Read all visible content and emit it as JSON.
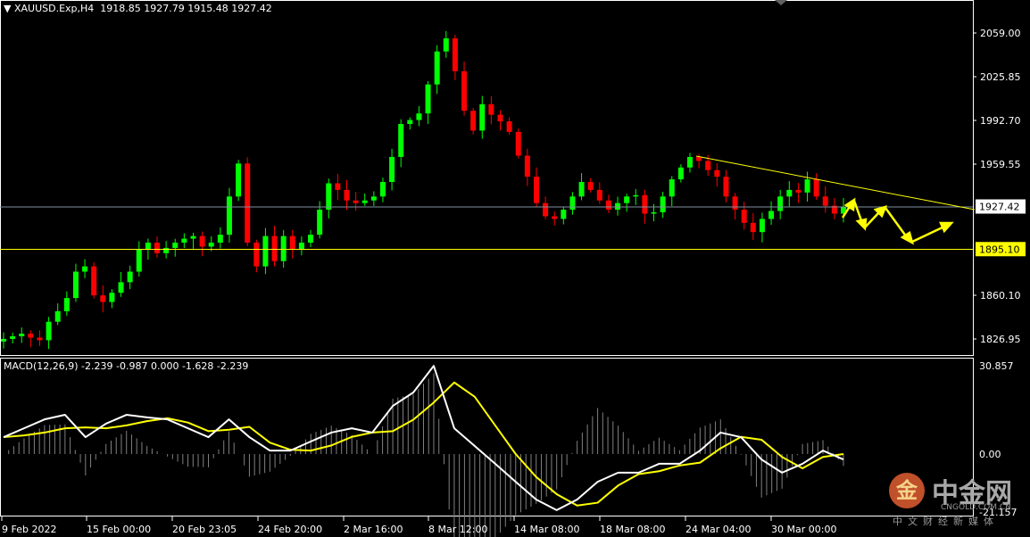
{
  "header": {
    "symbol": "XAUUSD.Exp,H4",
    "ohlc": "1918.85 1927.79 1915.48 1927.42"
  },
  "macd_header": "MACD(12,26,9) -2.239 -0.987 0.000 -1.628 -2.239",
  "colors": {
    "bull": "#00ff00",
    "bear": "#ff0000",
    "macd": "#ffffff",
    "signal": "#ffff00",
    "histogram": "#808080",
    "trendline": "#ffff00",
    "support": "#ffff00",
    "current": "#8090a0"
  },
  "watermark": {
    "logo": "金",
    "name": "中金网",
    "site": "CNGOLD.COM.CN",
    "tagline": "中文财经新媒体"
  },
  "chart_data": [
    {
      "type": "candlestick",
      "title": "XAUUSD.Exp,H4",
      "ylim": [
        1810,
        2075
      ],
      "yticks": [
        "2059.00",
        "2025.85",
        "1992.70",
        "1959.55",
        "1927.42",
        "1895.10",
        "1860.10",
        "1826.95"
      ],
      "xticks": [
        "9 Feb 2022",
        "15 Feb 00:00",
        "20 Feb 23:05",
        "24 Feb 20:00",
        "2 Mar 16:00",
        "8 Mar 12:00",
        "14 Mar 08:00",
        "18 Mar 08:00",
        "24 Mar 04:00",
        "30 Mar 00:00"
      ],
      "closes": [
        1827,
        1829,
        1831,
        1828,
        1826,
        1840,
        1848,
        1858,
        1878,
        1882,
        1860,
        1855,
        1862,
        1870,
        1878,
        1895,
        1900,
        1892,
        1896,
        1900,
        1903,
        1905,
        1897,
        1900,
        1906,
        1935,
        1960,
        1900,
        1882,
        1905,
        1886,
        1905,
        1895,
        1900,
        1906,
        1925,
        1945,
        1940,
        1932,
        1930,
        1932,
        1935,
        1946,
        1965,
        1990,
        1993,
        1998,
        2020,
        2045,
        2055,
        2030,
        2000,
        1985,
        2005,
        1997,
        1992,
        1984,
        1966,
        1950,
        1930,
        1920,
        1918,
        1925,
        1935,
        1946,
        1940,
        1932,
        1925,
        1930,
        1935,
        1936,
        1922,
        1923,
        1935,
        1948,
        1957,
        1965,
        1962,
        1955,
        1950,
        1935,
        1925,
        1915,
        1908,
        1918,
        1924,
        1935,
        1940,
        1938,
        1948,
        1935,
        1928,
        1922,
        1927.42
      ],
      "current_price": 1927.42,
      "support_level": 1895.1,
      "trendline": [
        1965.5,
        1925.0
      ]
    },
    {
      "type": "line",
      "title": "MACD(12,26,9)",
      "ylim": [
        -21.157,
        30.857
      ],
      "yticks": [
        "30.857",
        "0.00",
        "-21.157"
      ],
      "series": [
        {
          "name": "MACD",
          "values": [
            5.9,
            9.0,
            12.1,
            13.7,
            5.9,
            10.6,
            13.7,
            12.8,
            12.1,
            9.0,
            5.9,
            12.1,
            5.9,
            1.2,
            1.2,
            4.4,
            7.5,
            9.0,
            7.5,
            16.8,
            21.5,
            30.8,
            9.0,
            2.8,
            -3.4,
            -9.7,
            -15.9,
            -19.6,
            -15.9,
            -9.7,
            -6.5,
            -6.5,
            -3.4,
            -3.4,
            1.2,
            7.5,
            5.9,
            -1.9,
            -6.5,
            -3.4,
            1.2,
            -1.9
          ]
        },
        {
          "name": "Signal",
          "values": [
            5.9,
            6.5,
            7.5,
            9.0,
            9.3,
            9.0,
            10.0,
            11.5,
            12.5,
            11.0,
            8.0,
            8.5,
            9.5,
            4.0,
            1.5,
            1.2,
            3.0,
            6.0,
            7.5,
            8.0,
            12.0,
            18.0,
            25.0,
            20.0,
            10.0,
            0,
            -8,
            -14,
            -18,
            -17,
            -11,
            -7,
            -6,
            -4,
            -3,
            2,
            6,
            5,
            -1,
            -5,
            -1,
            0
          ]
        }
      ]
    }
  ]
}
